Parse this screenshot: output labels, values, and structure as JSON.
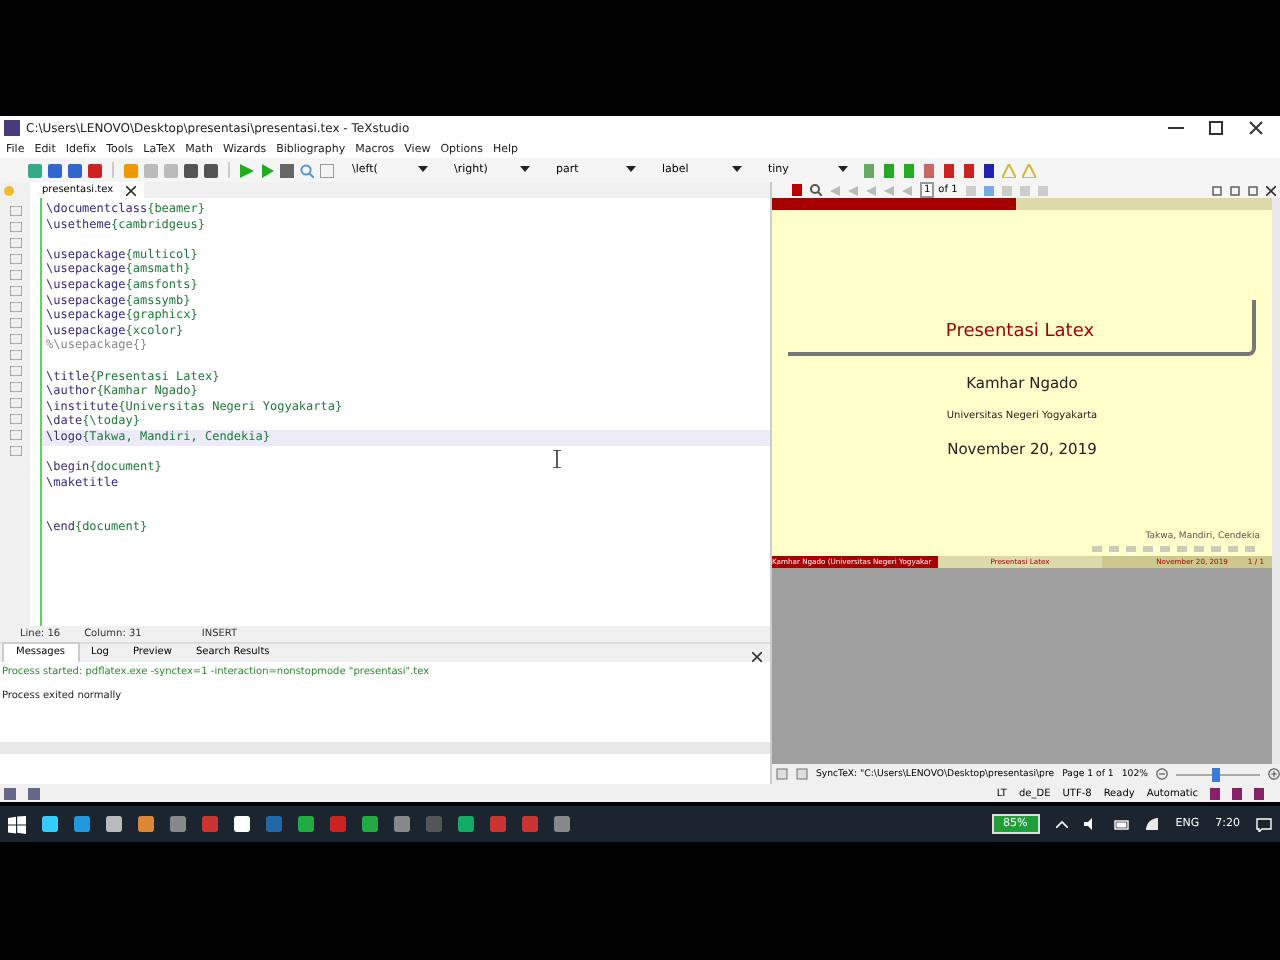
{
  "window": {
    "title": "C:\\Users\\LENOVO\\Desktop\\presentasi\\presentasi.tex - TeXstudio"
  },
  "menu": [
    "File",
    "Edit",
    "Idefix",
    "Tools",
    "LaTeX",
    "Math",
    "Wizards",
    "Bibliography",
    "Macros",
    "View",
    "Options",
    "Help"
  ],
  "toolbar": {
    "dropdowns": [
      "\\left(",
      "\\right)",
      "part",
      "label",
      "tiny"
    ]
  },
  "editor": {
    "tab": "presentasi.tex",
    "lines": [
      {
        "kind": "code",
        "command": "\\documentclass",
        "argument": "{beamer}",
        "highlighted": false
      },
      {
        "kind": "code",
        "command": "\\usetheme",
        "argument": "{cambridgeus}",
        "highlighted": false
      },
      {
        "kind": "blank",
        "highlighted": false
      },
      {
        "kind": "code",
        "command": "\\usepackage",
        "argument": "{multicol}",
        "highlighted": false
      },
      {
        "kind": "code",
        "command": "\\usepackage",
        "argument": "{amsmath}",
        "highlighted": false
      },
      {
        "kind": "code",
        "command": "\\usepackage",
        "argument": "{amsfonts}",
        "highlighted": false
      },
      {
        "kind": "code",
        "command": "\\usepackage",
        "argument": "{amssymb}",
        "highlighted": false
      },
      {
        "kind": "code",
        "command": "\\usepackage",
        "argument": "{graphicx}",
        "highlighted": false
      },
      {
        "kind": "code",
        "command": "\\usepackage",
        "argument": "{xcolor}",
        "highlighted": false
      },
      {
        "kind": "comment",
        "text": "%\\usepackage{}",
        "highlighted": false
      },
      {
        "kind": "blank",
        "highlighted": false
      },
      {
        "kind": "code",
        "command": "\\title",
        "argument": "{Presentasi Latex}",
        "highlighted": false
      },
      {
        "kind": "code",
        "command": "\\author",
        "argument": "{Kamhar Ngado}",
        "highlighted": false
      },
      {
        "kind": "code",
        "command": "\\institute",
        "argument": "{Universitas Negeri Yogyakarta}",
        "highlighted": false
      },
      {
        "kind": "code",
        "command": "\\date",
        "argument": "{\\today}",
        "highlighted": false
      },
      {
        "kind": "code",
        "command": "\\logo",
        "argument": "{Takwa, Mandiri, Cendekia}",
        "highlighted": true
      },
      {
        "kind": "blank",
        "highlighted": false
      },
      {
        "kind": "code",
        "command": "\\begin",
        "argument": "{document}",
        "highlighted": false
      },
      {
        "kind": "code",
        "command": "\\maketitle",
        "highlighted": false
      },
      {
        "kind": "blank",
        "highlighted": false
      },
      {
        "kind": "blank",
        "highlighted": false
      },
      {
        "kind": "code",
        "command": "\\end",
        "argument": "{document}",
        "highlighted": false
      }
    ],
    "status": {
      "line": "Line: 16",
      "column": "Column: 31",
      "mode": "INSERT"
    }
  },
  "messages": {
    "tabs": [
      {
        "label": "Messages",
        "selected": true
      },
      {
        "label": "Log",
        "selected": false
      },
      {
        "label": "Preview",
        "selected": false
      },
      {
        "label": "Search Results",
        "selected": false
      }
    ],
    "lines": [
      {
        "kind": "info",
        "text": "Process started: pdflatex.exe -synctex=1 -interaction=nonstopmode \"presentasi\".tex"
      },
      {
        "kind": "plain",
        "text": "Process exited normally"
      }
    ]
  },
  "pdf_viewer": {
    "page_field": "1",
    "page_total": "of 1",
    "slide": {
      "title": "Presentasi Latex",
      "author": "Kamhar Ngado",
      "institute": "Universitas Negeri Yogyakarta",
      "date": "November 20, 2019",
      "logo": "Takwa, Mandiri, Cendekia",
      "footer": [
        "Kamhar Ngado (Universitas Negeri Yogyakar",
        "Presentasi Latex",
        "November 20, 2019",
        "1 / 1"
      ]
    },
    "status": {
      "synctex": "SyncTeX: \"C:\\Users\\LENOVO\\Desktop\\presentasi\\pre",
      "page": "Page 1 of 1",
      "zoom": "102%",
      "zoom_slider": {
        "level": 0.47
      }
    }
  },
  "status_bar": [
    "LT",
    "de_DE",
    "UTF-8",
    "Ready",
    "Automatic"
  ],
  "taskbar": {
    "battery": "85%",
    "language": "ENG",
    "time": "7:20"
  }
}
